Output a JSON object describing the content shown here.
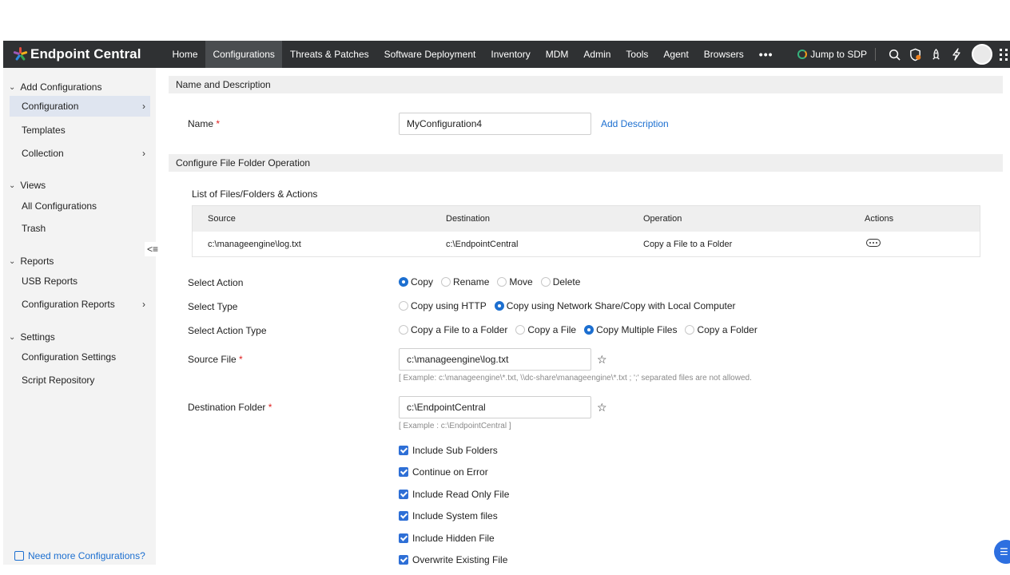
{
  "app": {
    "brand": "Endpoint Central"
  },
  "nav": {
    "items": [
      "Home",
      "Configurations",
      "Threats & Patches",
      "Software Deployment",
      "Inventory",
      "MDM",
      "Admin",
      "Tools",
      "Agent",
      "Browsers"
    ],
    "active": "Configurations",
    "more": "•••",
    "jump_label": "Jump to SDP"
  },
  "sidebar": {
    "add_configurations": "Add Configurations",
    "configuration": "Configuration",
    "templates": "Templates",
    "collection": "Collection",
    "views": "Views",
    "all_configurations": "All Configurations",
    "trash": "Trash",
    "reports": "Reports",
    "usb_reports": "USB Reports",
    "configuration_reports": "Configuration Reports",
    "settings": "Settings",
    "configuration_settings": "Configuration Settings",
    "script_repository": "Script Repository",
    "need_more": "Need more Configurations?"
  },
  "form": {
    "name_section": "Name and Description",
    "name_label": "Name",
    "name_value": "MyConfiguration4",
    "add_description": "Add Description",
    "operation_section": "Configure File Folder Operation",
    "list_title": "List of Files/Folders & Actions",
    "table": {
      "headers": [
        "Source",
        "Destination",
        "Operation",
        "Actions"
      ],
      "rows": [
        {
          "source": "c:\\manageengine\\log.txt",
          "destination": "c:\\EndpointCentral",
          "operation": "Copy a File to a Folder"
        }
      ]
    },
    "select_action_label": "Select Action",
    "actions": [
      "Copy",
      "Rename",
      "Move",
      "Delete"
    ],
    "selected_action": "Copy",
    "select_type_label": "Select Type",
    "types": [
      "Copy using HTTP",
      "Copy using Network Share/Copy with Local Computer"
    ],
    "selected_type": "Copy using Network Share/Copy with Local Computer",
    "select_action_type_label": "Select Action Type",
    "action_types": [
      "Copy a File to a Folder",
      "Copy a File",
      "Copy Multiple Files",
      "Copy a Folder"
    ],
    "selected_action_type": "Copy Multiple Files",
    "source_file_label": "Source File",
    "source_file_value": "c:\\manageengine\\log.txt",
    "source_hint": "[ Example: c:\\manageengine\\*.txt, \\\\dc-share\\manageengine\\*.txt ; ';' separated files are not allowed.",
    "destination_label": "Destination Folder",
    "destination_value": "c:\\EndpointCentral",
    "destination_hint": "[ Example : c:\\EndpointCentral ]",
    "options": [
      "Include Sub Folders",
      "Continue on Error",
      "Include Read Only File",
      "Include System files",
      "Include Hidden File",
      "Overwrite Existing File"
    ],
    "required_mark": "*"
  },
  "colors": {
    "accent": "#1c6fd0",
    "nav_bg": "#2f3133",
    "sidebar_bg": "#f3f3f3"
  }
}
